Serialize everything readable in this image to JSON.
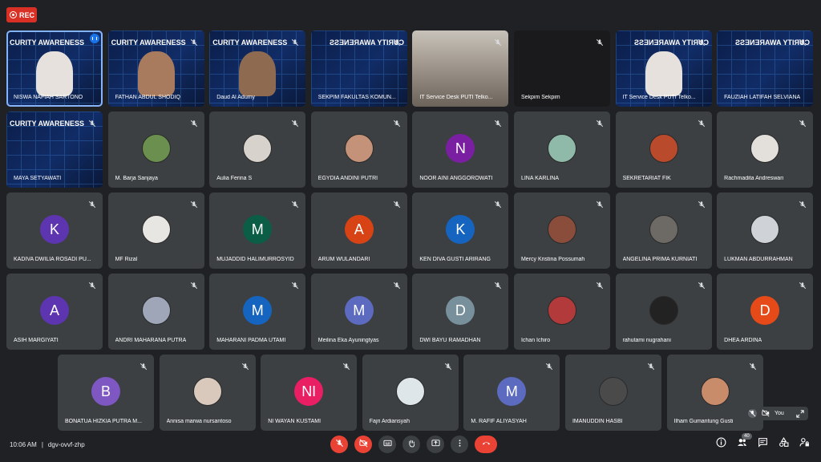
{
  "rec_label": "REC",
  "meeting": {
    "time": "10:06 AM",
    "separator": "|",
    "code": "dgv-ovvf-zhp"
  },
  "participant_count": "40",
  "self_view": {
    "label": "You"
  },
  "banner_text": "CURITY AWARENESS",
  "banner_text_mirror": "CURITY AWARENESS",
  "rows": [
    [
      {
        "name": "NISWA NAFIAH SARTONO",
        "type": "video",
        "banner": "normal",
        "face": "hijab",
        "speaking": true
      },
      {
        "name": "FATHAN ABDUL SHODIQ",
        "type": "video",
        "banner": "normal",
        "face": "mask"
      },
      {
        "name": "Daud Al Adumy",
        "type": "video",
        "banner": "normal",
        "face": "glass"
      },
      {
        "name": "SEKPIM FAKULTAS KOMUN...",
        "type": "video",
        "banner": "mirror"
      },
      {
        "name": "IT Service Desk PUTI Telko...",
        "type": "video",
        "style": "room"
      },
      {
        "name": "Sekpim Sekpim",
        "type": "video",
        "style": "dark"
      },
      {
        "name": "IT Service Desk PUTI Telko...",
        "type": "video",
        "banner": "mirror",
        "face": "hijab"
      },
      {
        "name": "FAUZIAH LATIFAH SELVIANA",
        "type": "video",
        "banner": "mirror"
      }
    ],
    [
      {
        "name": "MAYA SETYAWATI",
        "type": "video",
        "banner": "normal"
      },
      {
        "name": "M. Barja Sanjaya",
        "type": "photo",
        "color": "#6b8f4e"
      },
      {
        "name": "Aulia Ferina S",
        "type": "photo",
        "color": "#d7d2cc"
      },
      {
        "name": "EGYDIA ANDINI PUTRI",
        "type": "photo",
        "color": "#c49278"
      },
      {
        "name": "NOOR AINI ANGGOROWATI",
        "type": "initial",
        "initial": "N",
        "color": "#7b1fa2"
      },
      {
        "name": "LINA KARLINA",
        "type": "photo",
        "color": "#8fb9a8"
      },
      {
        "name": "SEKRETARIAT FIK",
        "type": "photo",
        "color": "#b94a2c"
      },
      {
        "name": "Rachmadita Andreswari",
        "type": "photo",
        "color": "#e3e0dc"
      }
    ],
    [
      {
        "name": "KADIVA DWILIA ROSADI PU...",
        "type": "initial",
        "initial": "K",
        "color": "#5e35b1"
      },
      {
        "name": "MF Rizal",
        "type": "photo",
        "color": "#e8e6e3"
      },
      {
        "name": "MUJADDID HALIMURROSYID",
        "type": "initial",
        "initial": "M",
        "color": "#0b5e45"
      },
      {
        "name": "ARUM WULANDARI",
        "type": "initial",
        "initial": "A",
        "color": "#d84315"
      },
      {
        "name": "KEN DIVA GUSTI ARIRANG",
        "type": "initial",
        "initial": "K",
        "color": "#1565c0"
      },
      {
        "name": "Mercy Kristina Possumah",
        "type": "photo",
        "color": "#8a4d3c"
      },
      {
        "name": "ANGELINA PRIMA KURNIATI",
        "type": "photo",
        "color": "#6d6a66"
      },
      {
        "name": "LUKMAN ABDURRAHMAN",
        "type": "photo",
        "color": "#cfd3d8"
      }
    ],
    [
      {
        "name": "ASIH MARGIYATI",
        "type": "initial",
        "initial": "A",
        "color": "#5e35b1"
      },
      {
        "name": "ANDRI MAHARANA PUTRA",
        "type": "photo",
        "color": "#9ea6b8"
      },
      {
        "name": "MAHARANI PADMA UTAMI",
        "type": "initial",
        "initial": "M",
        "color": "#1565c0"
      },
      {
        "name": "Meilina Eka Ayuningtyas",
        "type": "initial",
        "initial": "M",
        "color": "#5c6bc0"
      },
      {
        "name": "DWI BAYU RAMADHAN",
        "type": "initial",
        "initial": "D",
        "color": "#78909c"
      },
      {
        "name": "Ichan Ichiro",
        "type": "photo",
        "color": "#b23a3a"
      },
      {
        "name": "rahutami nugrahani",
        "type": "photo",
        "color": "#222222"
      },
      {
        "name": "DHEA ARDINA",
        "type": "initial",
        "initial": "D",
        "color": "#e64a19"
      }
    ],
    [
      {
        "name": "BONATUA HIZKIA PUTRA M...",
        "type": "initial",
        "initial": "B",
        "color": "#7e57c2"
      },
      {
        "name": "Annisa marwa nursantoso",
        "type": "photo",
        "color": "#d9c9bd"
      },
      {
        "name": "NI WAYAN KUSTAMI",
        "type": "initial",
        "initial": "NI",
        "color": "#e91e63"
      },
      {
        "name": "Fajri Ardiansyah",
        "type": "photo",
        "color": "#dfe6e9"
      },
      {
        "name": "M. RAFIF ALIYASYAH",
        "type": "initial",
        "initial": "M",
        "color": "#5c6bc0"
      },
      {
        "name": "IMANUDDIN HASBI",
        "type": "photo",
        "color": "#4a4a4a"
      },
      {
        "name": "Ilham Gumantung Gusti",
        "type": "photo",
        "color": "#c98c6b"
      }
    ]
  ]
}
